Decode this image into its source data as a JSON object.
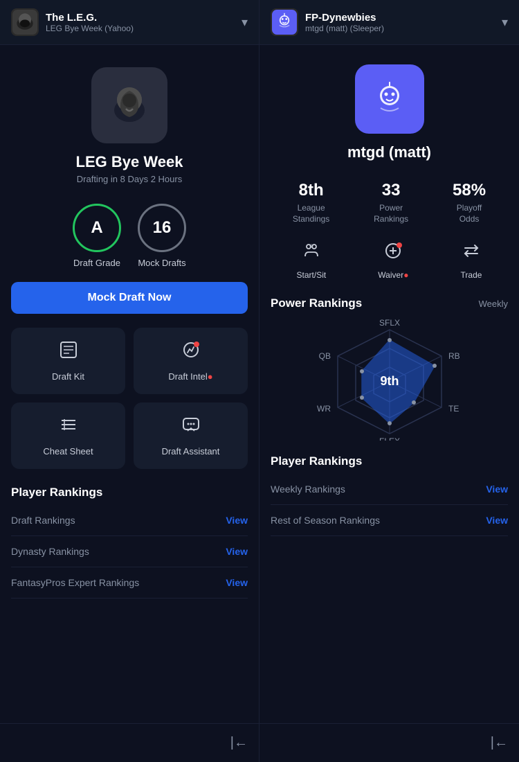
{
  "leftPanel": {
    "header": {
      "title": "The L.E.G.",
      "subtitle": "LEG Bye Week (Yahoo)",
      "chevron": "▾"
    },
    "league": {
      "name": "LEG Bye Week",
      "draftingInfo": "Drafting in 8 Days 2 Hours"
    },
    "stats": {
      "grade": {
        "value": "A",
        "label": "Draft Grade",
        "color": "green"
      },
      "mockDrafts": {
        "value": "16",
        "label": "Mock Drafts",
        "color": "gray"
      }
    },
    "mockDraftButton": "Mock Draft Now",
    "tools": [
      {
        "id": "draft-kit",
        "label": "Draft Kit",
        "icon": "📋",
        "hasDot": false
      },
      {
        "id": "draft-intel",
        "label": "Draft Intel",
        "icon": "📊",
        "hasDot": true
      },
      {
        "id": "cheat-sheet",
        "label": "Cheat Sheet",
        "icon": "☰",
        "hasDot": false
      },
      {
        "id": "draft-assistant",
        "label": "Draft Assistant",
        "icon": "💬",
        "hasDot": false
      }
    ],
    "playerRankings": {
      "title": "Player Rankings",
      "items": [
        {
          "name": "Draft Rankings",
          "linkLabel": "View"
        },
        {
          "name": "Dynasty Rankings",
          "linkLabel": "View"
        },
        {
          "name": "FantasyPros Expert Rankings",
          "linkLabel": "View"
        }
      ]
    },
    "backIcon": "|←"
  },
  "rightPanel": {
    "header": {
      "title": "FP-Dynewbies",
      "subtitle": "mtgd (matt) (Sleeper)",
      "chevron": "▾"
    },
    "user": {
      "name": "mtgd (matt)"
    },
    "stats": [
      {
        "value": "8th",
        "desc": "League\nStandings"
      },
      {
        "value": "33",
        "desc": "Power\nRankings"
      },
      {
        "value": "58%",
        "desc": "Playoff\nOdds"
      }
    ],
    "actions": [
      {
        "id": "start-sit",
        "label": "Start/Sit",
        "hasDot": false
      },
      {
        "id": "waiver",
        "label": "Waiver",
        "hasDot": true
      },
      {
        "id": "trade",
        "label": "Trade",
        "hasDot": false
      }
    ],
    "powerRankings": {
      "title": "Power Rankings",
      "period": "Weekly",
      "rank": "9th",
      "radarLabels": {
        "top": "SFLX",
        "topRight": "RB",
        "right": "TE",
        "bottomRight": "FLEX",
        "bottom": "WR",
        "left": "QB"
      }
    },
    "playerRankings": {
      "title": "Player Rankings",
      "items": [
        {
          "name": "Weekly Rankings",
          "linkLabel": "View"
        },
        {
          "name": "Rest of Season Rankings",
          "linkLabel": "View"
        }
      ]
    },
    "backIcon": "|←"
  }
}
